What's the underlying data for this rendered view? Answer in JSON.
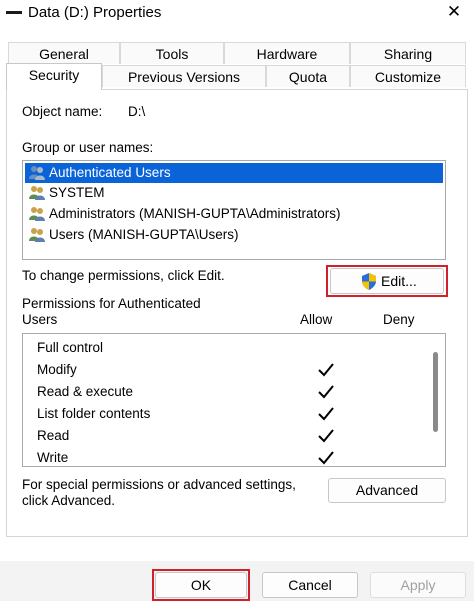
{
  "window": {
    "title": "Data (D:) Properties",
    "close_glyph": "✕"
  },
  "tabs_row1": [
    "General",
    "Tools",
    "Hardware",
    "Sharing"
  ],
  "tabs_row2": [
    "Security",
    "Previous Versions",
    "Quota",
    "Customize"
  ],
  "active_tab": "Security",
  "object": {
    "label": "Object name:",
    "value": "D:\\"
  },
  "group_label": "Group or user names:",
  "users": [
    {
      "name": "Authenticated Users",
      "selected": true
    },
    {
      "name": "SYSTEM",
      "selected": false
    },
    {
      "name": "Administrators (MANISH-GUPTA\\Administrators)",
      "selected": false
    },
    {
      "name": "Users (MANISH-GUPTA\\Users)",
      "selected": false
    }
  ],
  "change_text": "To change permissions, click Edit.",
  "edit_button": "Edit...",
  "permissions_for": "Permissions for Authenticated Users",
  "col_allow": "Allow",
  "col_deny": "Deny",
  "permissions": [
    {
      "name": "Full control",
      "allow": false
    },
    {
      "name": "Modify",
      "allow": true
    },
    {
      "name": "Read & execute",
      "allow": true
    },
    {
      "name": "List folder contents",
      "allow": true
    },
    {
      "name": "Read",
      "allow": true
    },
    {
      "name": "Write",
      "allow": true
    }
  ],
  "special_text": "For special permissions or advanced settings, click Advanced.",
  "advanced_button": "Advanced",
  "footer": {
    "ok": "OK",
    "cancel": "Cancel",
    "apply": "Apply"
  },
  "colors": {
    "selection": "#0a64d8",
    "highlight": "#d0202a"
  }
}
